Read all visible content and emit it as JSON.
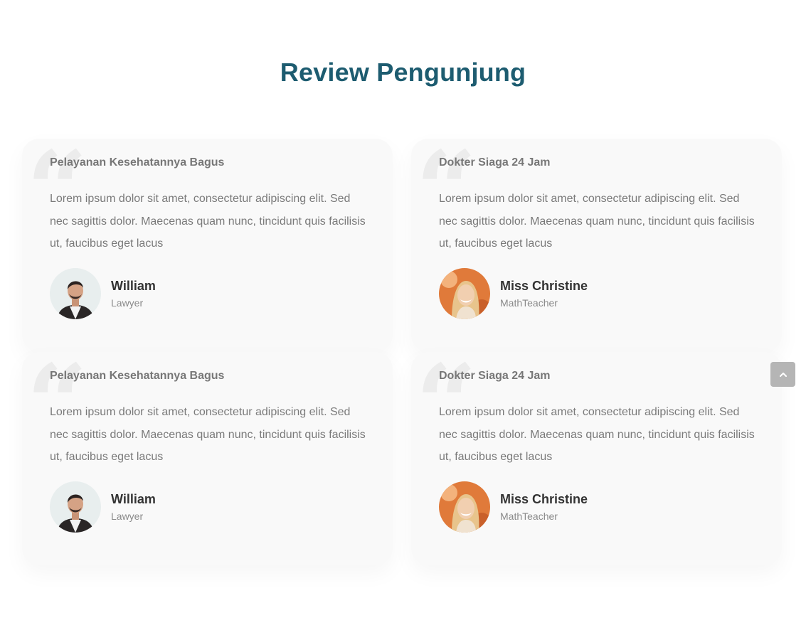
{
  "section": {
    "title": "Review Pengunjung"
  },
  "reviews": [
    {
      "title": "Pelayanan Kesehatannya Bagus",
      "text": "Lorem ipsum dolor sit amet, consectetur adipiscing elit. Sed nec sagittis dolor. Maecenas quam nunc, tincidunt quis facilisis ut, faucibus eget lacus",
      "name": "William",
      "role": "Lawyer",
      "avatar": "man-portrait"
    },
    {
      "title": "Dokter Siaga 24 Jam",
      "text": "Lorem ipsum dolor sit amet, consectetur adipiscing elit. Sed nec sagittis dolor. Maecenas quam nunc, tincidunt quis facilisis ut, faucibus eget lacus",
      "name": "Miss Christine",
      "role": "MathTeacher",
      "avatar": "woman-portrait"
    },
    {
      "title": "Pelayanan Kesehatannya Bagus",
      "text": "Lorem ipsum dolor sit amet, consectetur adipiscing elit. Sed nec sagittis dolor. Maecenas quam nunc, tincidunt quis facilisis ut, faucibus eget lacus",
      "name": "William",
      "role": "Lawyer",
      "avatar": "man-portrait"
    },
    {
      "title": "Dokter Siaga 24 Jam",
      "text": "Lorem ipsum dolor sit amet, consectetur adipiscing elit. Sed nec sagittis dolor. Maecenas quam nunc, tincidunt quis facilisis ut, faucibus eget lacus",
      "name": "Miss Christine",
      "role": "MathTeacher",
      "avatar": "woman-portrait"
    }
  ],
  "icons": {
    "quote": "quote-icon",
    "scroll_top": "chevron-up-icon"
  },
  "colors": {
    "title": "#1d5c70",
    "card_background": "#f9f9f9",
    "scroll_top_button": "#b5b5b5"
  }
}
